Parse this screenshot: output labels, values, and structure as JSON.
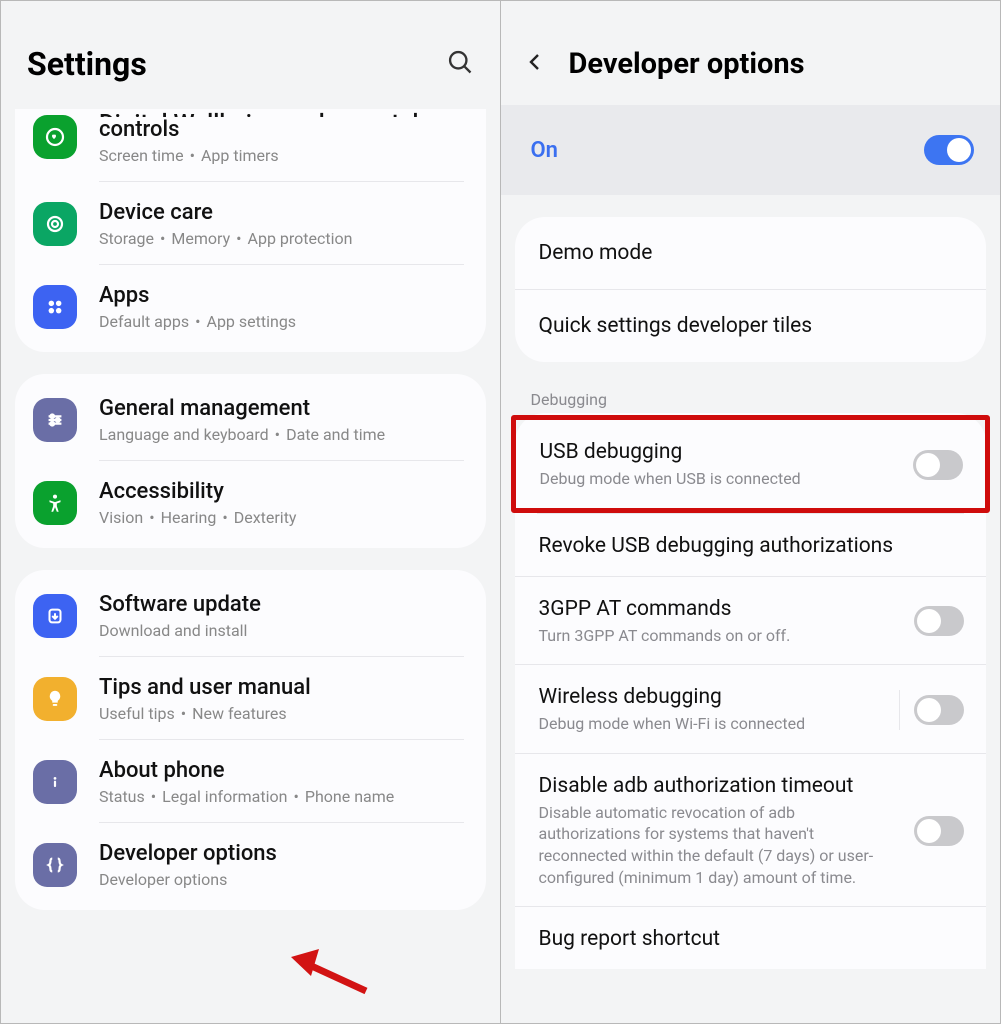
{
  "left": {
    "header_title": "Settings",
    "rows": [
      {
        "title_line2": "controls",
        "sub1": "Screen time",
        "sub2": "App timers",
        "icon": "heart",
        "bg": "#0aa12e"
      },
      {
        "title": "Device care",
        "sub1": "Storage",
        "sub2": "Memory",
        "sub3": "App protection",
        "icon": "device-care",
        "bg": "#0aa664"
      },
      {
        "title": "Apps",
        "sub1": "Default apps",
        "sub2": "App settings",
        "icon": "apps-grid",
        "bg": "#3d63f2"
      },
      {
        "title": "General management",
        "sub1": "Language and keyboard",
        "sub2": "Date and time",
        "icon": "sliders",
        "bg": "#6a6ea6"
      },
      {
        "title": "Accessibility",
        "sub1": "Vision",
        "sub2": "Hearing",
        "sub3": "Dexterity",
        "icon": "accessibility",
        "bg": "#0aa12e"
      },
      {
        "title": "Software update",
        "sub1": "Download and install",
        "icon": "software-update",
        "bg": "#3d63f2"
      },
      {
        "title": "Tips and user manual",
        "sub1": "Useful tips",
        "sub2": "New features",
        "icon": "tips",
        "bg": "#f2b02e"
      },
      {
        "title": "About phone",
        "sub1": "Status",
        "sub2": "Legal information",
        "sub3": "Phone name",
        "icon": "info",
        "bg": "#6a6ea6"
      },
      {
        "title": "Developer options",
        "sub1": "Developer options",
        "icon": "braces",
        "bg": "#6a6ea6"
      }
    ]
  },
  "right": {
    "header_title": "Developer options",
    "on_label": "On",
    "group1": [
      "Demo mode",
      "Quick settings developer tiles"
    ],
    "section_label": "Debugging",
    "items": [
      {
        "title": "USB debugging",
        "sub": "Debug mode when USB is connected",
        "toggle": "off",
        "highlight": true
      },
      {
        "title": "Revoke USB debugging authorizations"
      },
      {
        "title": "3GPP AT commands",
        "sub": "Turn 3GPP AT commands on or off.",
        "toggle": "off"
      },
      {
        "title": "Wireless debugging",
        "sub": "Debug mode when Wi-Fi is connected",
        "toggle": "off"
      },
      {
        "title": "Disable adb authorization timeout",
        "sub": "Disable automatic revocation of adb authorizations for systems that haven't reconnected within the default (7 days) or user-configured (minimum 1 day) amount of time.",
        "toggle": "off"
      },
      {
        "title": "Bug report shortcut"
      }
    ]
  }
}
